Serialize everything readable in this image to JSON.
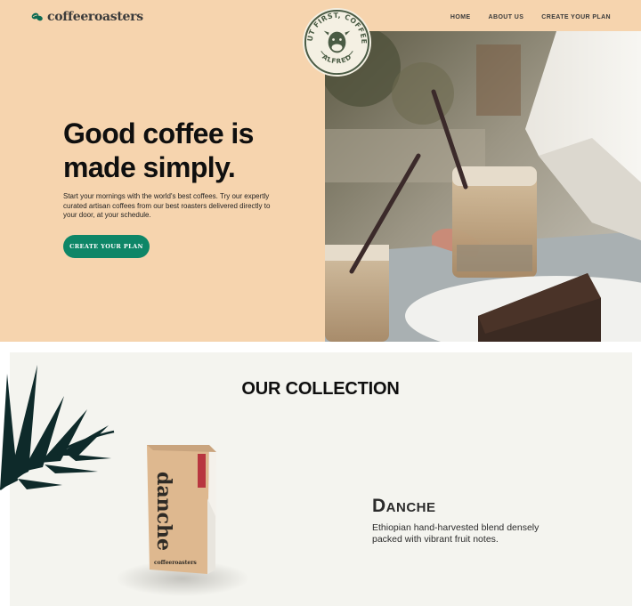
{
  "brand": {
    "name": "coffeeroasters"
  },
  "nav": [
    {
      "label": "HOME"
    },
    {
      "label": "ABOUT US"
    },
    {
      "label": "CREATE YOUR PLAN"
    }
  ],
  "badge": {
    "top_text": "BUT FIRST, COFFEE.",
    "bottom_text": "ALFRED"
  },
  "hero": {
    "headline_line1": "Good coffee is",
    "headline_line2": "made simply.",
    "description": "Start your mornings with the world's best coffees. Try our expertly curated artisan coffees from our best roasters delivered directly to your door, at your schedule.",
    "cta_label": "Create your plan"
  },
  "collection": {
    "title": "OUR COLLECTION",
    "product": {
      "bag_label": "danche",
      "bag_brand": "coffeeroasters",
      "name": "Danche",
      "description": "Ethiopian hand-harvested blend densely packed with vibrant fruit notes."
    }
  },
  "colors": {
    "hero_bg": "#f6d4ae",
    "accent": "#0e8667",
    "collection_bg": "#f4f4ef",
    "palm": "#0e2a2a",
    "badge_green": "#4a5b44"
  }
}
